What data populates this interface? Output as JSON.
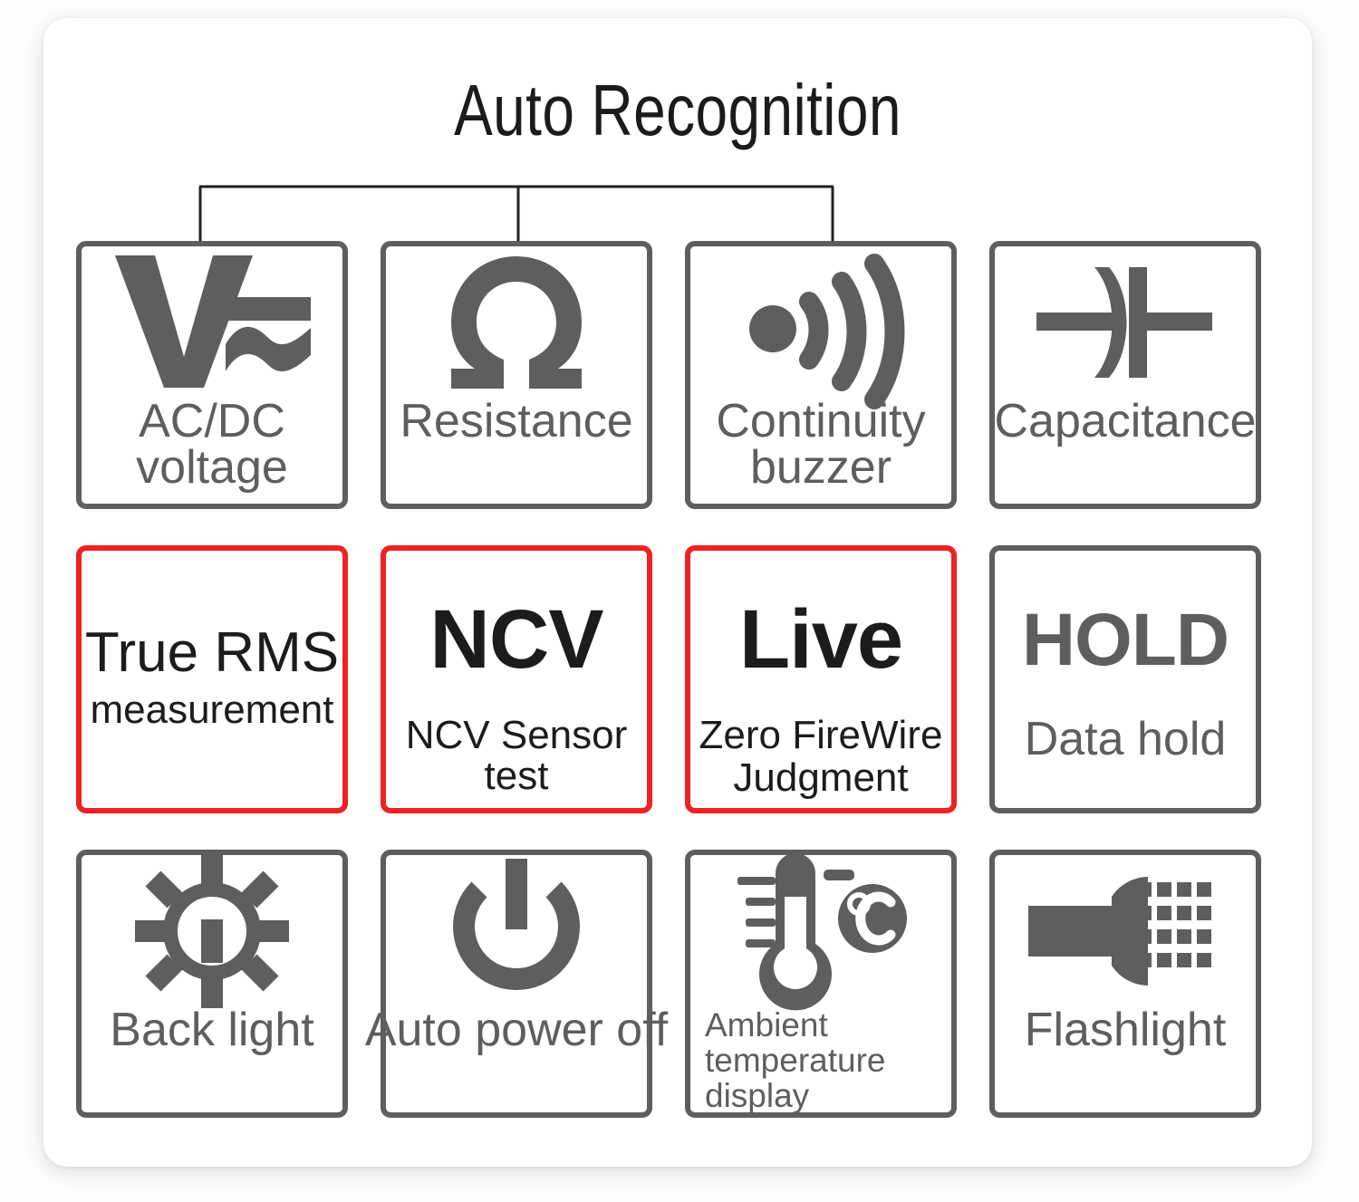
{
  "header": {
    "title": "Auto Recognition"
  },
  "bracket": {
    "color": "#222222",
    "stem_count": 3
  },
  "theme": {
    "gray": "#5e5e5e",
    "red": "#ee2222",
    "dark_text": "#1c1c1c",
    "panel_bg": "#ffffff",
    "page_bg": "#fdfdfd"
  },
  "cards": [
    {
      "id": "ac-dc-voltage",
      "icon": "voltage-ac-dc-icon",
      "border": "gray",
      "label_line1": "AC/DC",
      "label_line2": "voltage",
      "bracketed": true
    },
    {
      "id": "resistance",
      "icon": "omega-resistance-icon",
      "border": "gray",
      "label_line1": "Resistance",
      "label_line2": "",
      "bracketed": true
    },
    {
      "id": "continuity-buzzer",
      "icon": "sound-wave-icon",
      "border": "gray",
      "label_line1": "Continuity",
      "label_line2": "buzzer",
      "bracketed": true
    },
    {
      "id": "capacitance",
      "icon": "capacitor-icon",
      "border": "gray",
      "label_line1": "Capacitance",
      "label_line2": "",
      "bracketed": false
    },
    {
      "id": "true-rms",
      "icon": "none",
      "border": "red",
      "title_text": "True RMS",
      "sub_text": "measurement"
    },
    {
      "id": "ncv",
      "icon": "none",
      "border": "red",
      "title_text": "NCV",
      "sub_text": "NCV Sensor test"
    },
    {
      "id": "live",
      "icon": "none",
      "border": "red",
      "title_text": "Live",
      "sub_text_line1": "Zero FireWire",
      "sub_text_line2": "Judgment"
    },
    {
      "id": "hold",
      "icon": "none",
      "border": "gray",
      "title_text": "HOLD",
      "sub_text": "Data hold"
    },
    {
      "id": "back-light",
      "icon": "brightness-sun-icon",
      "border": "gray",
      "label_line1": "Back light",
      "label_line2": ""
    },
    {
      "id": "auto-power-off",
      "icon": "power-icon",
      "border": "gray",
      "label_line1": "Auto power off",
      "label_line2": ""
    },
    {
      "id": "ambient-temperature",
      "icon": "thermometer-celsius-icon",
      "border": "gray",
      "label_line1": "Ambient temperature",
      "label_line2": "display"
    },
    {
      "id": "flashlight",
      "icon": "flashlight-icon",
      "border": "gray",
      "label_line1": "Flashlight",
      "label_line2": ""
    }
  ]
}
